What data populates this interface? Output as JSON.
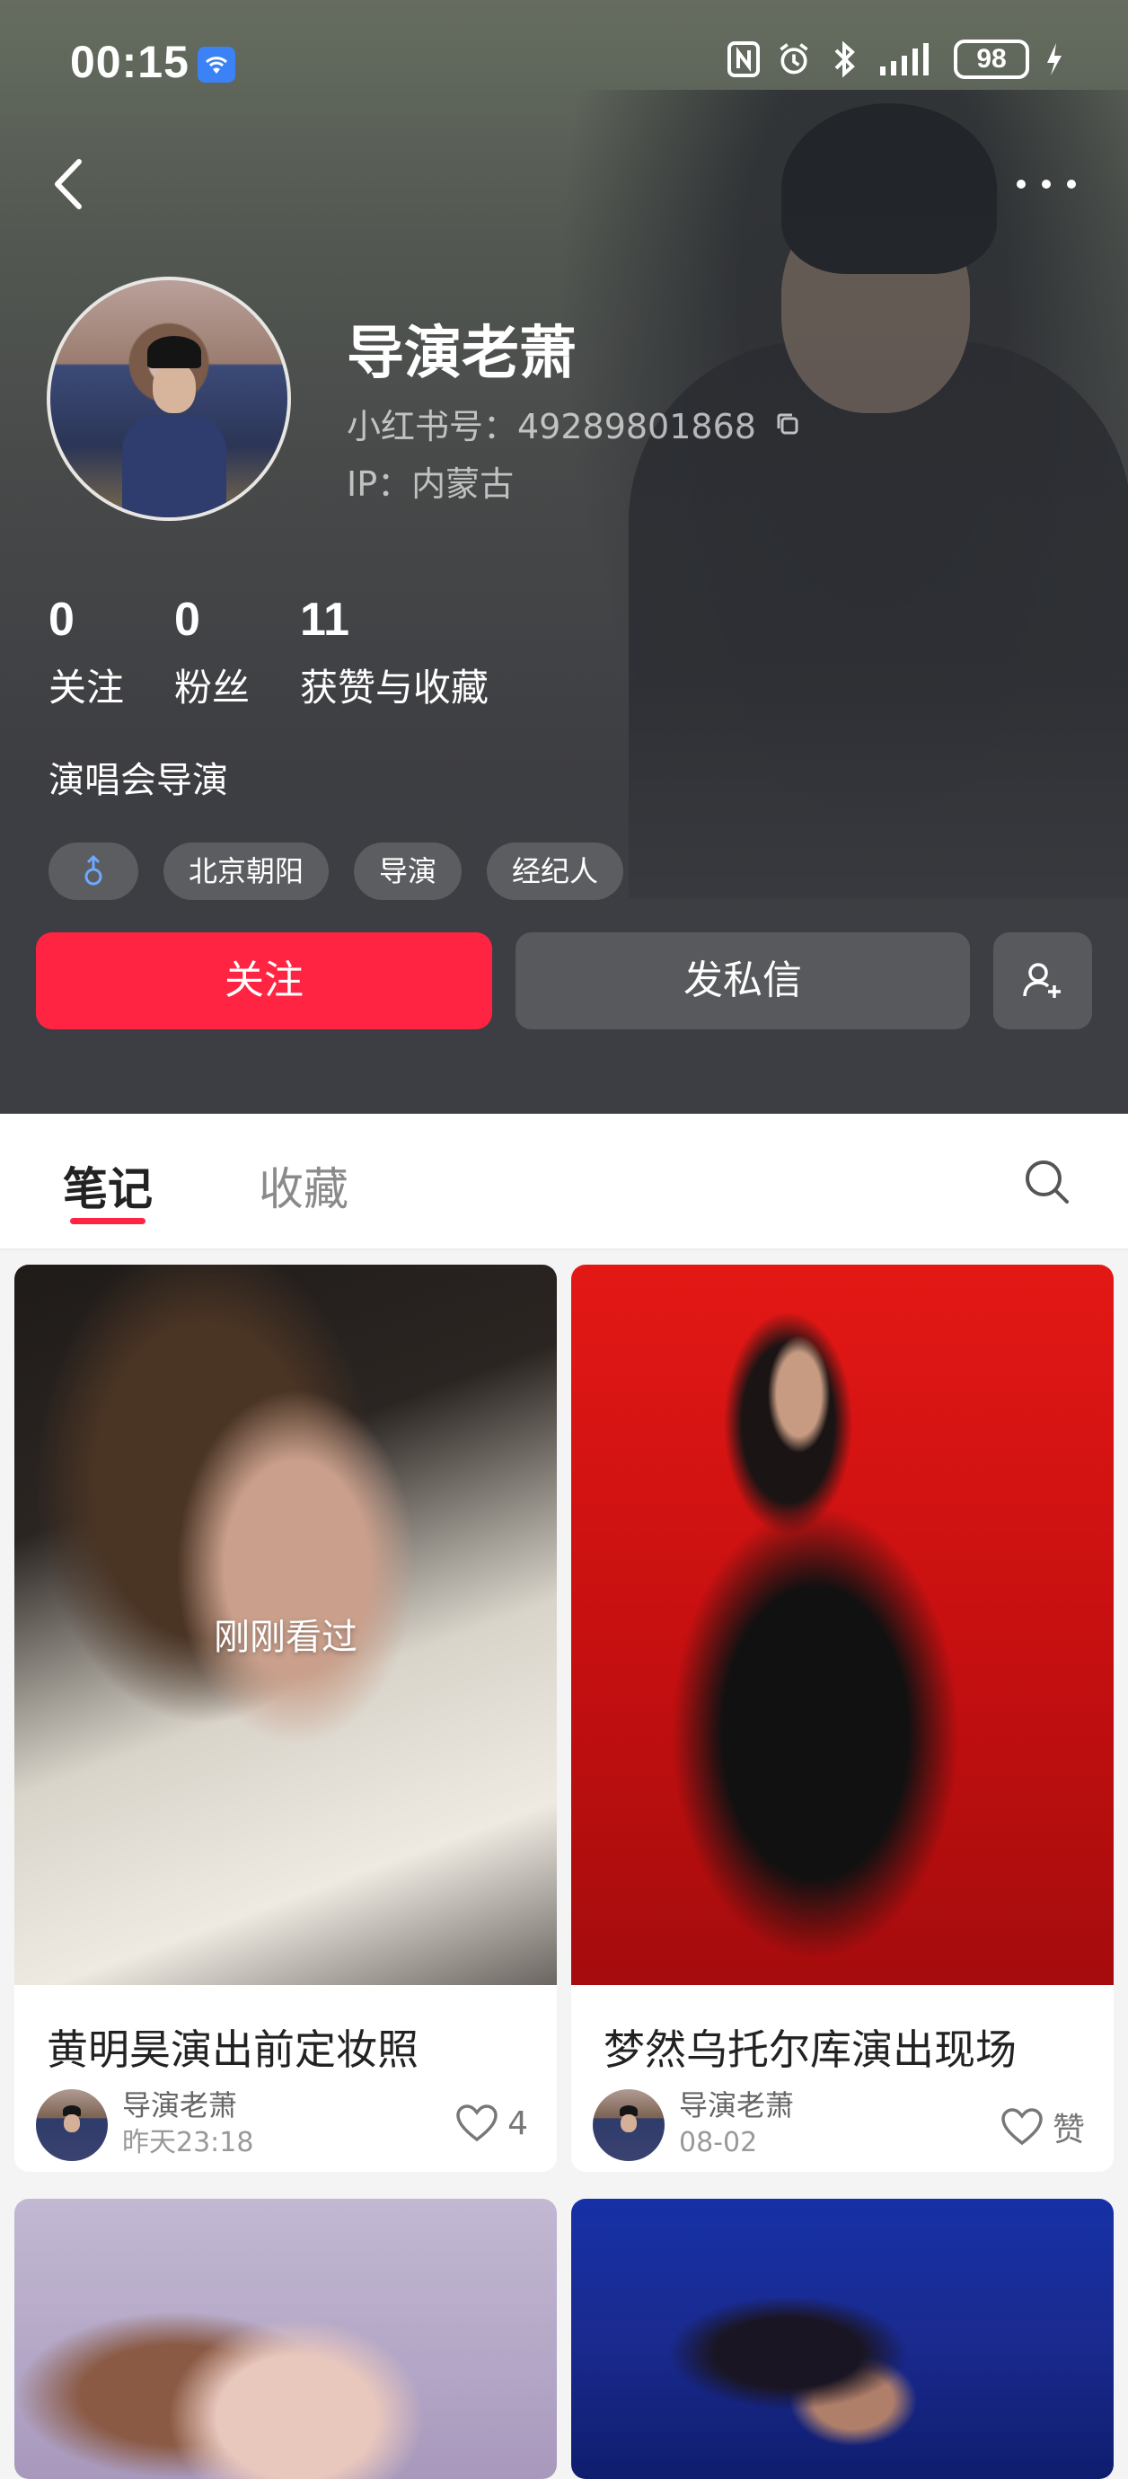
{
  "status_bar": {
    "time": "00:15",
    "battery": "98",
    "icons": [
      "wifi-icon",
      "nfc-icon",
      "alarm-icon",
      "bluetooth-icon",
      "signal-icon",
      "charging-icon"
    ]
  },
  "nav": {
    "back_icon": "back-arrow-icon",
    "more_icon": "more-dots-icon"
  },
  "profile": {
    "name": "导演老萧",
    "redbook_id": "小红书号：49289801868",
    "ip": "IP：内蒙古",
    "bio": "演唱会导演",
    "stats": [
      {
        "value": "0",
        "label": "关注"
      },
      {
        "value": "0",
        "label": "粉丝"
      },
      {
        "value": "11",
        "label": "获赞与收藏"
      }
    ],
    "tags": [
      "北京朝阳",
      "导演",
      "经纪人"
    ],
    "gender_icon": "male-icon"
  },
  "actions": {
    "follow": "关注",
    "message": "发私信",
    "add_friend_icon": "add-user-icon"
  },
  "tabs": {
    "notes": "笔记",
    "favorites": "收藏",
    "search_icon": "search-icon"
  },
  "posts": [
    {
      "title": "黄明昊演出前定妆照",
      "author": "导演老萧",
      "time": "昨天23:18",
      "likes": "4",
      "overlay": "刚刚看过"
    },
    {
      "title": "梦然乌托尔库演出现场",
      "author": "导演老萧",
      "time": "08-02",
      "likes": "赞"
    },
    {
      "title": "",
      "author": "",
      "time": "",
      "likes": ""
    },
    {
      "title": "",
      "author": "",
      "time": "",
      "likes": ""
    }
  ],
  "colors": {
    "accent": "#ff2442",
    "header_bg": "#3d3e43"
  }
}
